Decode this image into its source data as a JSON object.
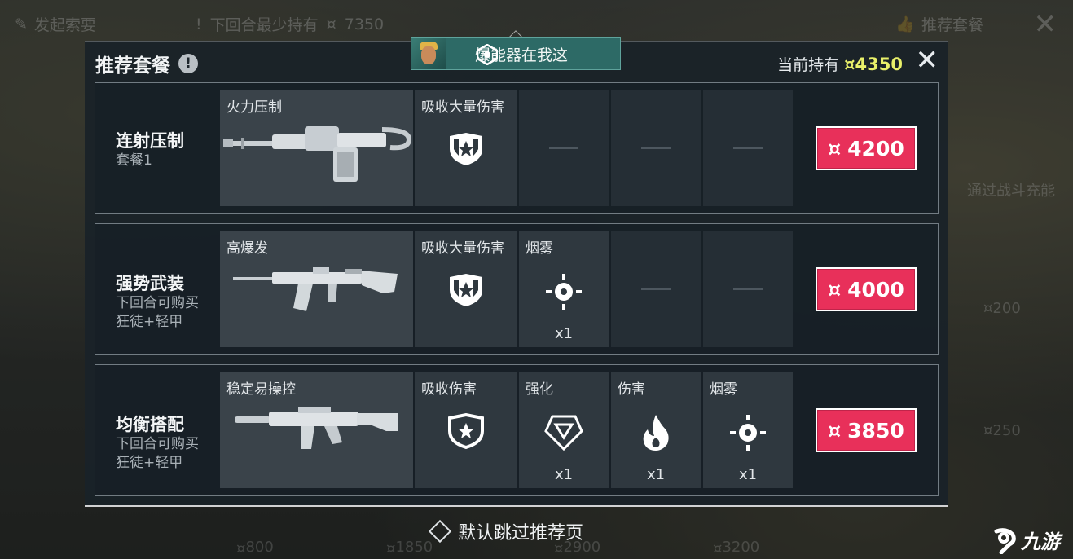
{
  "background": {
    "top_left_label": "发起索要",
    "top_warning": "下回合最少持有",
    "top_warning_amount": "7350",
    "top_right_label": "推荐套餐",
    "side_label": "通过战斗充能",
    "side_price_1": "200",
    "side_price_2": "250",
    "bottom_price_1": "800",
    "bottom_price_2": "1850",
    "bottom_price_3": "2900",
    "bottom_price_4": "3200"
  },
  "panel": {
    "title": "推荐套餐",
    "balance_label": "当前持有",
    "balance_amount": "4350",
    "spike_text": "爆能器在我这"
  },
  "packages": [
    {
      "name": "连射压制",
      "sub": "套餐1",
      "weapon_label": "火力压制",
      "slots": [
        {
          "label": "吸收大量伤害",
          "icon": "heavy-shield-icon",
          "qty": ""
        },
        {
          "label": "",
          "icon": "",
          "qty": ""
        },
        {
          "label": "",
          "icon": "",
          "qty": ""
        },
        {
          "label": "",
          "icon": "",
          "qty": ""
        }
      ],
      "price": "4200"
    },
    {
      "name": "强势武装",
      "sub": "下回合可购买\n狂徒+轻甲",
      "sub_line1": "下回合可购买",
      "sub_line2": "狂徒+轻甲",
      "weapon_label": "高爆发",
      "slots": [
        {
          "label": "吸收大量伤害",
          "icon": "heavy-shield-icon",
          "qty": ""
        },
        {
          "label": "烟雾",
          "icon": "smoke-target-icon",
          "qty": "x1"
        },
        {
          "label": "",
          "icon": "",
          "qty": ""
        },
        {
          "label": "",
          "icon": "",
          "qty": ""
        }
      ],
      "price": "4000"
    },
    {
      "name": "均衡搭配",
      "sub_line1": "下回合可购买",
      "sub_line2": "狂徒+轻甲",
      "weapon_label": "稳定易操控",
      "slots": [
        {
          "label": "吸收伤害",
          "icon": "light-shield-icon",
          "qty": ""
        },
        {
          "label": "强化",
          "icon": "boost-triangle-icon",
          "qty": "x1"
        },
        {
          "label": "伤害",
          "icon": "fire-icon",
          "qty": "x1"
        },
        {
          "label": "烟雾",
          "icon": "smoke-target-icon",
          "qty": "x1"
        }
      ],
      "price": "3850"
    }
  ],
  "footer": {
    "toggle_label": "默认跳过推荐页"
  },
  "watermark": "九游",
  "colors": {
    "price_button": "#e8305a",
    "balance_amount": "#e9f06a",
    "spike_banner": "#2d6a66"
  }
}
